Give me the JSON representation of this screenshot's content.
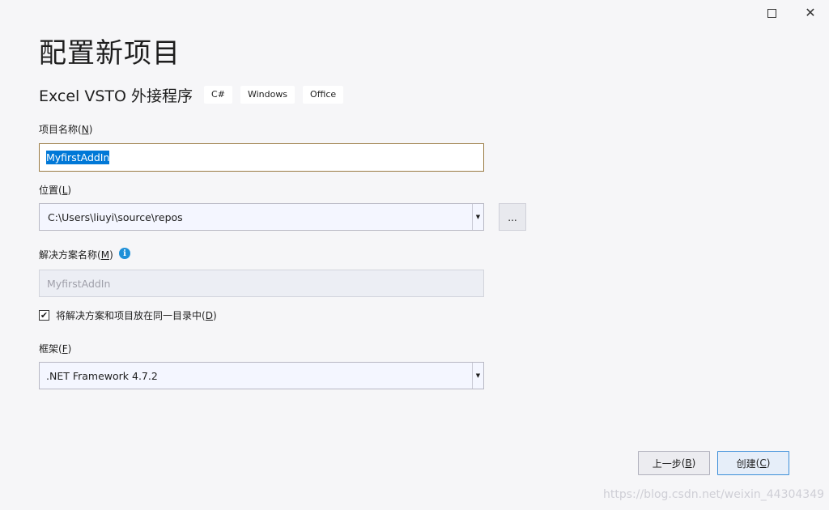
{
  "window": {
    "maximize_icon": "maximize-icon",
    "close_icon": "close-icon"
  },
  "page_title": "配置新项目",
  "template": {
    "name": "Excel VSTO 外接程序",
    "tags": [
      "C#",
      "Windows",
      "Office"
    ]
  },
  "project_name": {
    "label": "项目名称",
    "accel": "N",
    "value": "MyfirstAddIn"
  },
  "location": {
    "label": "位置",
    "accel": "L",
    "value": "C:\\Users\\liuyi\\source\\repos",
    "browse_label": "..."
  },
  "solution_name": {
    "label": "解决方案名称",
    "accel": "M",
    "info_icon": "info-icon",
    "value": "MyfirstAddIn"
  },
  "same_dir": {
    "checked": true,
    "label": "将解决方案和项目放在同一目录中",
    "accel": "D"
  },
  "framework": {
    "label": "框架",
    "accel": "F",
    "value": ".NET Framework 4.7.2"
  },
  "buttons": {
    "back": {
      "label": "上一步",
      "accel": "B"
    },
    "create": {
      "label": "创建",
      "accel": "C"
    }
  },
  "watermark": "https://blog.csdn.net/weixin_44304349"
}
